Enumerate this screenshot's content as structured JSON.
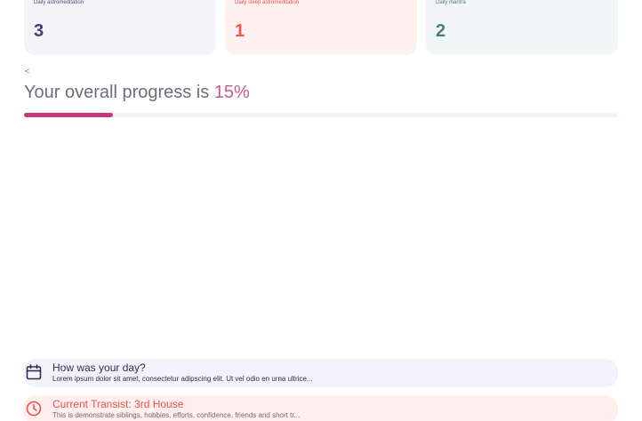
{
  "stats": [
    {
      "label": "Daily astromeditation",
      "value": "3"
    },
    {
      "label": "Daily sleep astromeditation",
      "value": "1"
    },
    {
      "label": "Daily mantra",
      "value": "2"
    }
  ],
  "progress": {
    "back_glyph": "<",
    "heading_prefix": "Your overall progress is ",
    "heading_percent": "15%",
    "fraction": 0.15
  },
  "feed": [
    {
      "icon": "calendar-icon",
      "title": "How was your day?",
      "description": "Lorem ipsum dolor sit amet, consectetur adipscing elit. Ut vel odio en urna ultrice..."
    },
    {
      "icon": "clock-icon",
      "title": "Current Transist: 3rd House",
      "description": "This is demonstrate siblings, hobbies, efforts, confidence, friends and short tr..."
    }
  ],
  "colors": {
    "accent": "#c8377a",
    "astro": "#3f4270",
    "sleep": "#f0554a",
    "mantra": "#4c7d7f"
  }
}
